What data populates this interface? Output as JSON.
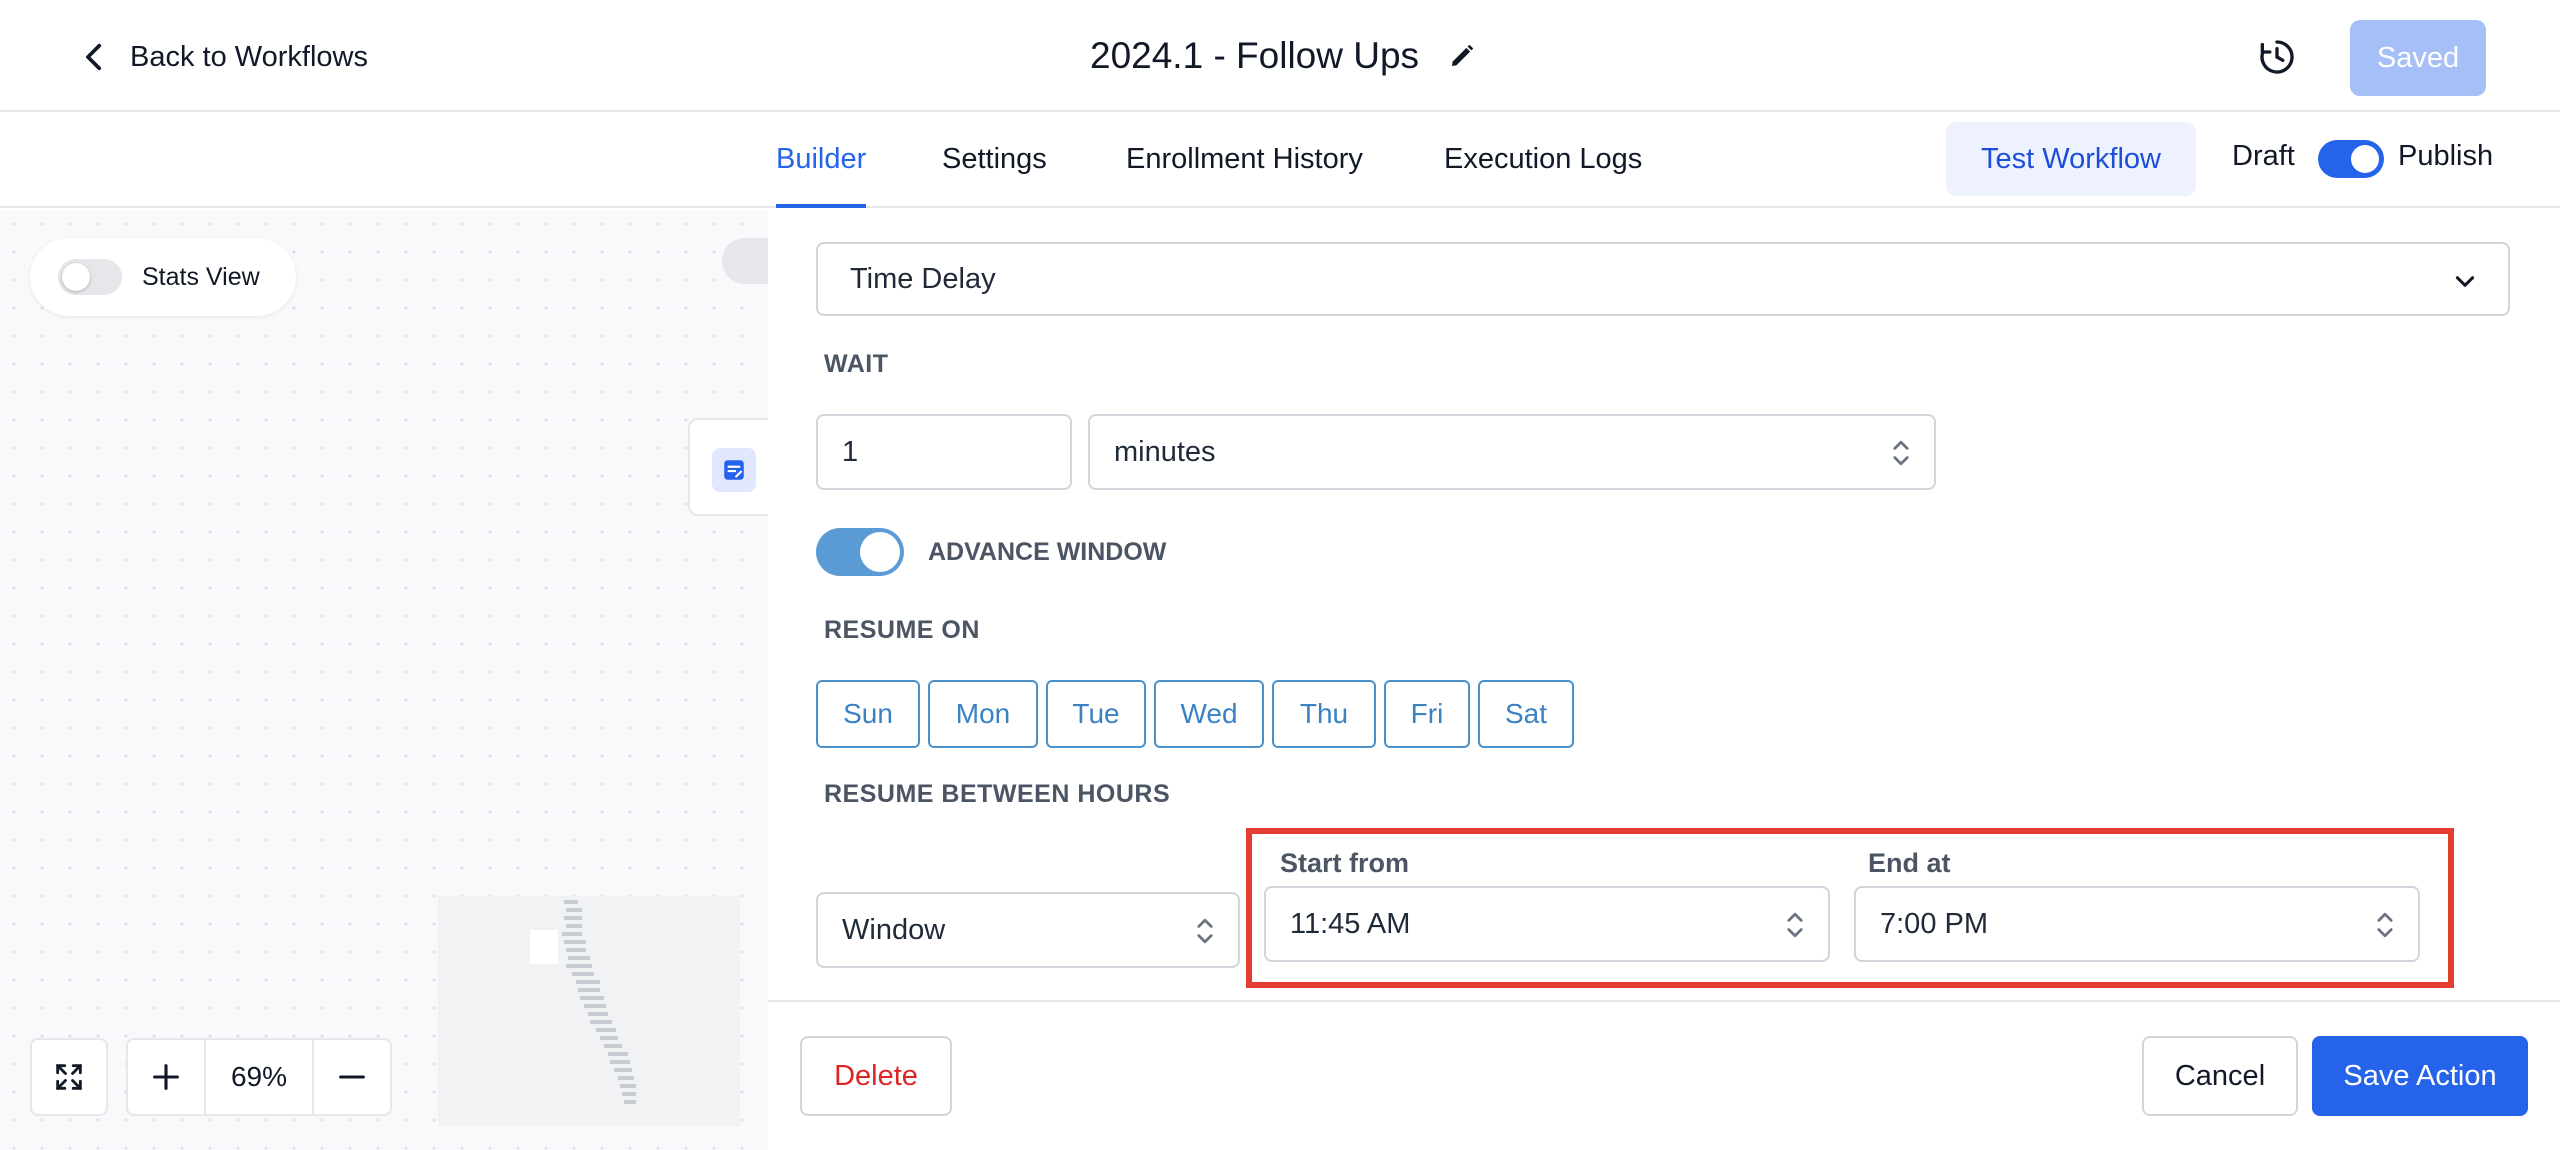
{
  "header": {
    "back_label": "Back to Workflows",
    "workflow_title": "2024.1 - Follow Ups",
    "saved_label": "Saved"
  },
  "tabs": [
    {
      "label": "Builder",
      "active": true
    },
    {
      "label": "Settings",
      "active": false
    },
    {
      "label": "Enrollment History",
      "active": false
    },
    {
      "label": "Execution Logs",
      "active": false
    }
  ],
  "toolbar": {
    "test_label": "Test Workflow",
    "draft_label": "Draft",
    "publish_label": "Publish",
    "publish_on": true
  },
  "canvas": {
    "stats_view_label": "Stats View",
    "stats_view_on": false,
    "zoom_level": "69%"
  },
  "action": {
    "type_value": "Time Delay",
    "wait_label": "WAIT",
    "wait_amount": "1",
    "wait_unit": "minutes",
    "advance_window_label": "ADVANCE WINDOW",
    "advance_window_on": true,
    "resume_on_label": "RESUME ON",
    "days": [
      "Sun",
      "Mon",
      "Tue",
      "Wed",
      "Thu",
      "Fri",
      "Sat"
    ],
    "resume_hours_label": "RESUME BETWEEN HOURS",
    "window_mode": "Window",
    "start_label": "Start from",
    "start_value": "11:45 AM",
    "end_label": "End at",
    "end_value": "7:00 PM"
  },
  "footer": {
    "delete_label": "Delete",
    "cancel_label": "Cancel",
    "save_label": "Save Action"
  },
  "colors": {
    "primary": "#2563eb",
    "saved_disabled": "#a7bff7",
    "delete_text": "#dc2626",
    "highlight_box": "#e53e30",
    "day_outline": "#4a90c9"
  }
}
